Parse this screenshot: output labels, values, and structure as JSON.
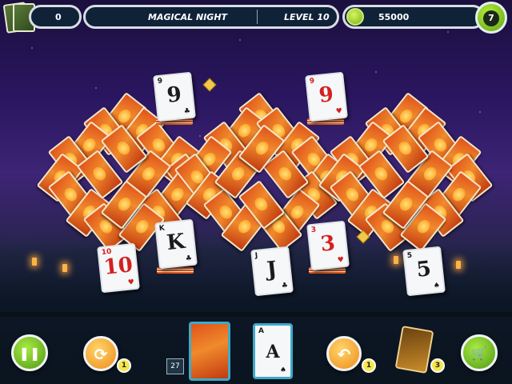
{
  "hud": {
    "score": "0",
    "level_name": "MAGICAL NIGHT",
    "level_label": "LEVEL 10",
    "coins": "55000",
    "player_level": "7"
  },
  "board": {
    "face_cards": [
      {
        "rank": "9",
        "suit": "♣",
        "color": "black"
      },
      {
        "rank": "9",
        "suit": "♥",
        "color": "red"
      },
      {
        "rank": "K",
        "suit": "♣",
        "color": "black"
      },
      {
        "rank": "10",
        "suit": "♥",
        "color": "red"
      },
      {
        "rank": "J",
        "suit": "♣",
        "color": "black"
      },
      {
        "rank": "3",
        "suit": "♥",
        "color": "red"
      },
      {
        "rank": "5",
        "suit": "♠",
        "color": "black"
      }
    ]
  },
  "controls": {
    "pause_glyph": "❚❚",
    "shuffle_count": "1",
    "stock_count": "27",
    "waste_card": {
      "rank": "A",
      "suit": "♠"
    },
    "undo_count": "1",
    "joker_count": "3",
    "shop_glyph": "🛒"
  },
  "colors": {
    "accent_green": "#7bb31a",
    "tile_orange": "#e0531b",
    "hud_bg": "#0f2238"
  }
}
